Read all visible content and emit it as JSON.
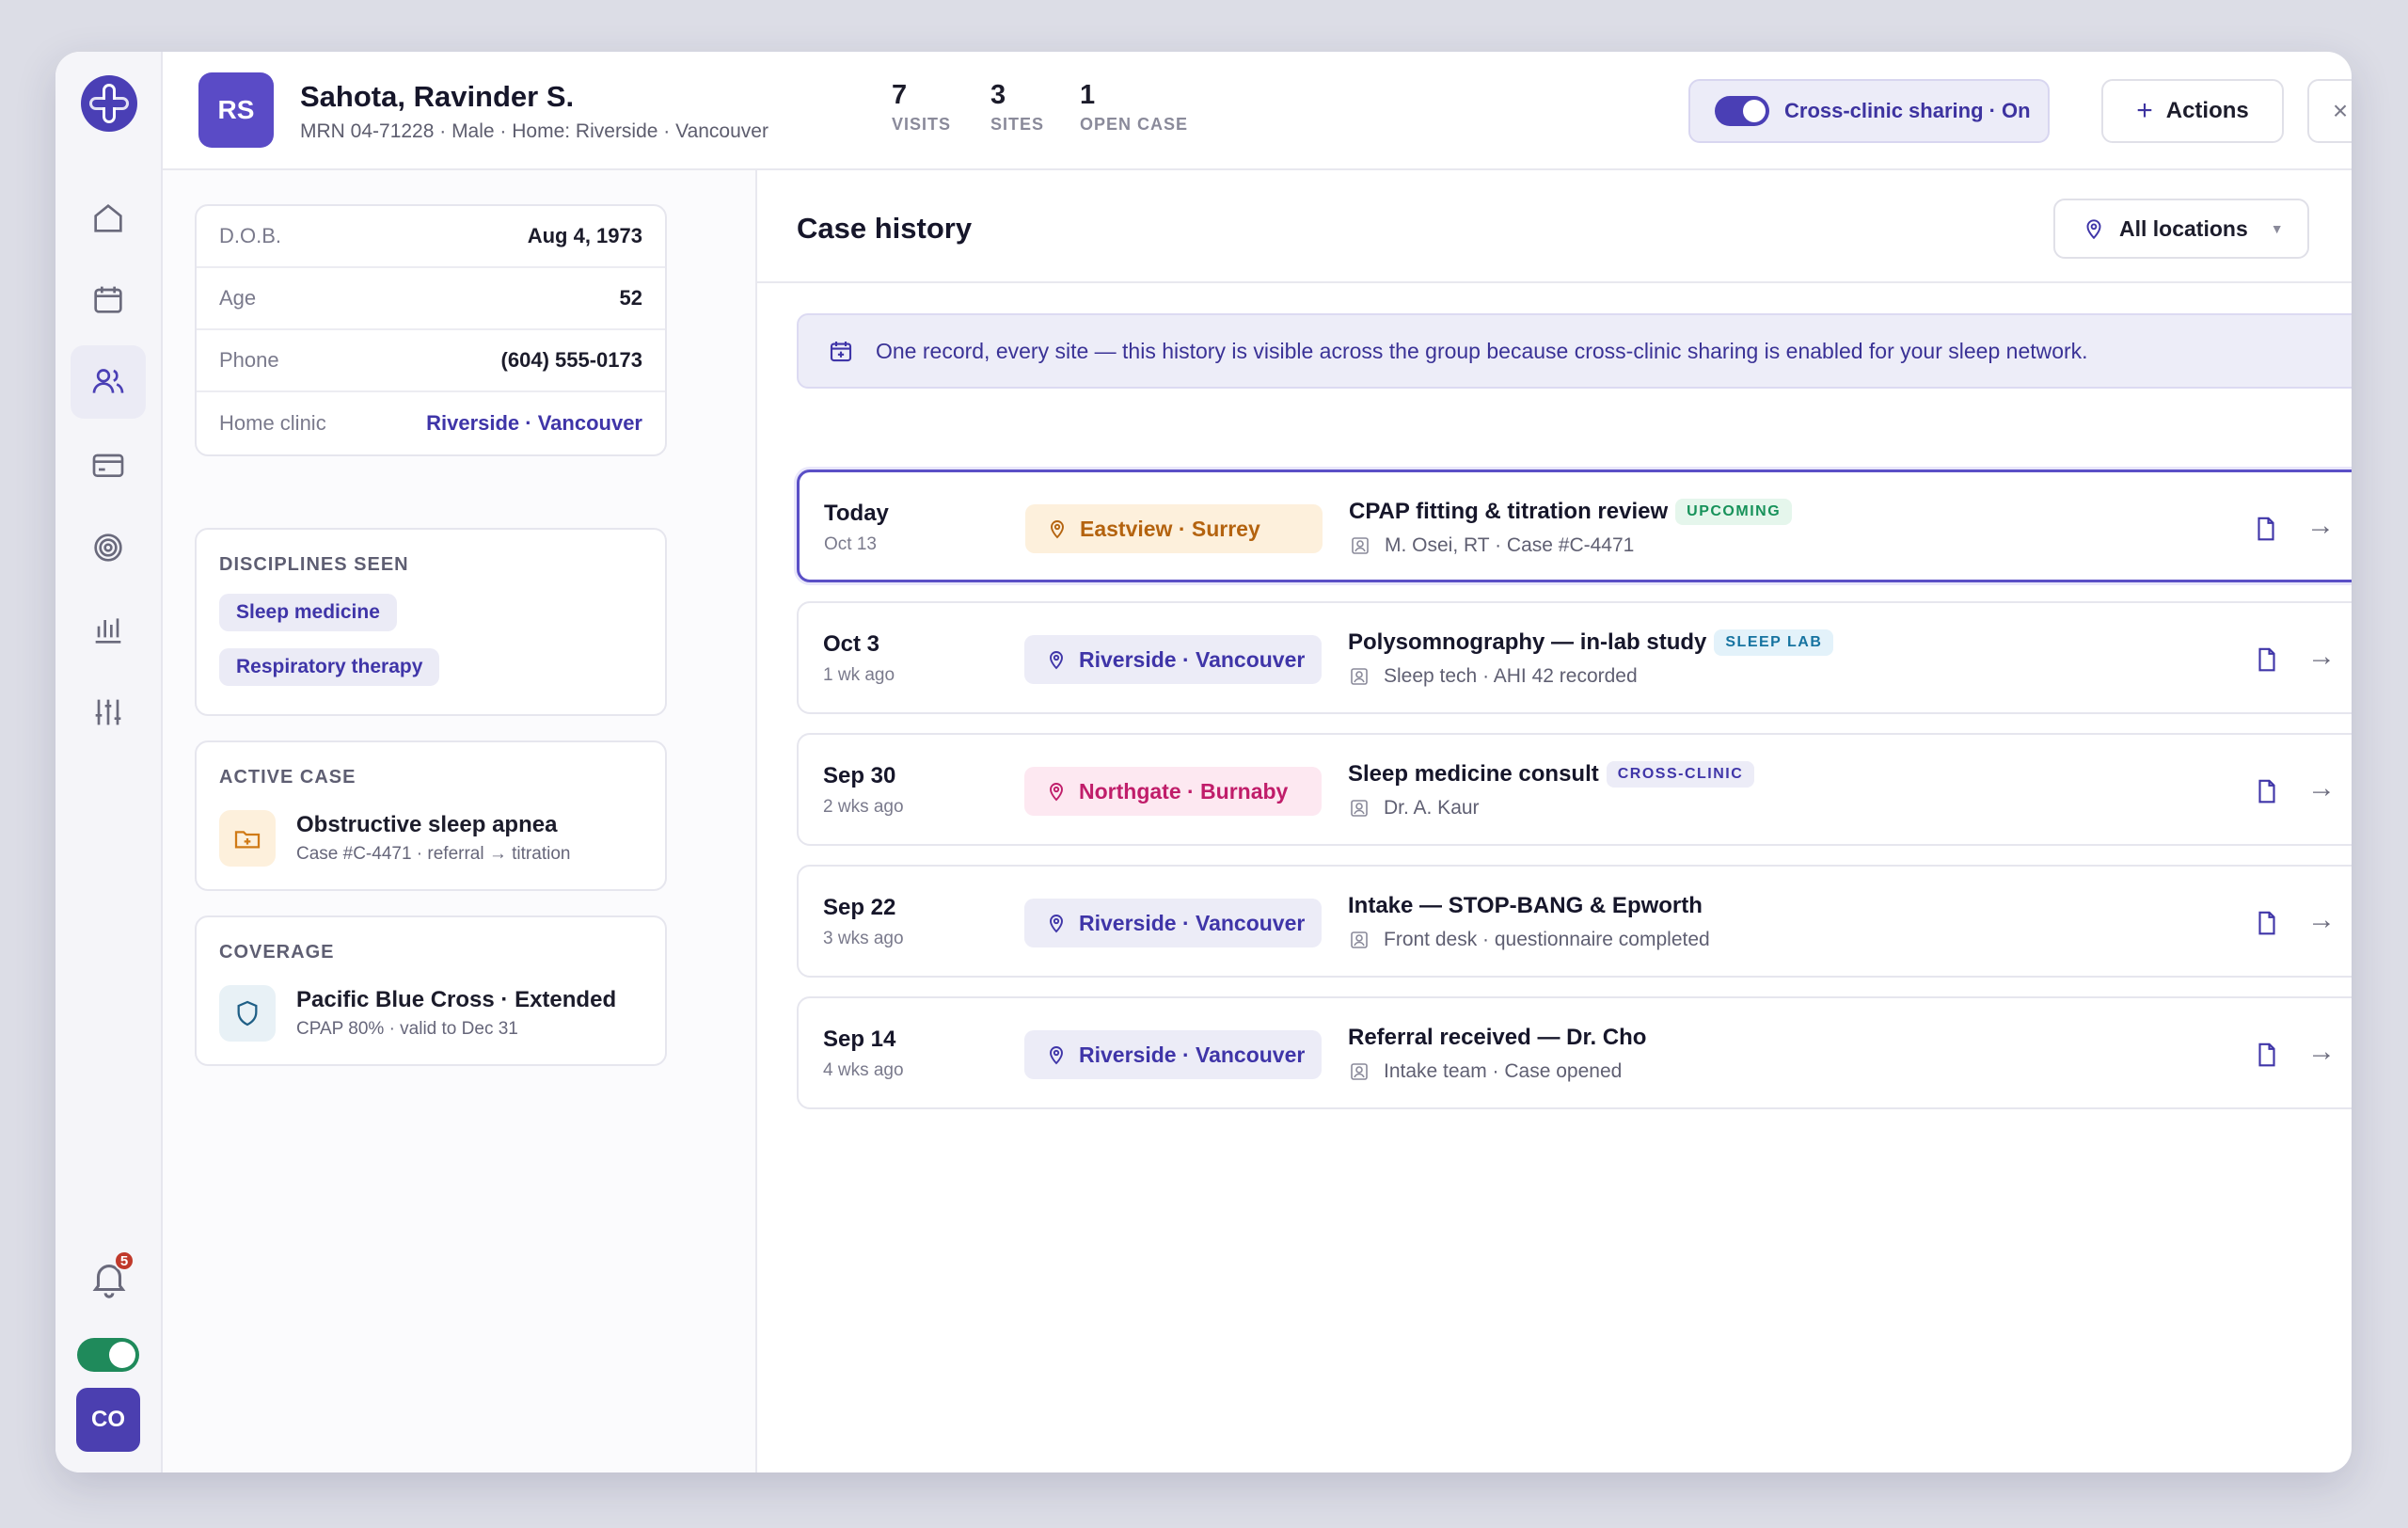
{
  "patient": {
    "initials": "RS",
    "name": "Sahota, Ravinder S.",
    "meta": "MRN 04-71228 · Male · Home: Riverside · Vancouver",
    "stats": [
      {
        "num": "7",
        "label": "VISITS"
      },
      {
        "num": "3",
        "label": "SITES"
      },
      {
        "num": "1",
        "label": "OPEN CASE"
      }
    ]
  },
  "header": {
    "sharing_label": "Cross-clinic sharing · On",
    "actions_label": "Actions",
    "close_label": "×"
  },
  "sidebar": {
    "notification_count": "5",
    "user_initials": "CO",
    "toggle_on": true
  },
  "details": [
    {
      "key": "D.O.B.",
      "value": "Aug 4, 1973"
    },
    {
      "key": "Age",
      "value": "52"
    },
    {
      "key": "Phone",
      "value": "(604) 555-0173"
    },
    {
      "key": "Home clinic",
      "value": "Riverside · Vancouver"
    }
  ],
  "disciplines": {
    "title": "DISCIPLINES SEEN",
    "items": [
      "Sleep medicine",
      "Respiratory therapy"
    ]
  },
  "active_case": {
    "title": "ACTIVE CASE",
    "name": "Obstructive sleep apnea",
    "sub": "Case #C-4471 · referral → titration"
  },
  "coverage": {
    "title": "COVERAGE",
    "name": "Pacific Blue Cross · Extended",
    "sub": "CPAP 80% · valid to Dec 31"
  },
  "history": {
    "title": "Case history",
    "filter_label": "All locations",
    "banner": "One record, every site — this history is visible across the group because cross-clinic sharing is enabled for your sleep network.",
    "rows": [
      {
        "date": "Today",
        "ago": "Oct 13",
        "location": "Eastview · Surrey",
        "title": "CPAP fitting & titration review",
        "tag": "UPCOMING",
        "sub": "M. Osei, RT · Case #C-4471"
      },
      {
        "date": "Oct 3",
        "ago": "1 wk ago",
        "location": "Riverside · Vancouver",
        "title": "Polysomnography — in-lab study",
        "tag": "SLEEP LAB",
        "sub": "Sleep tech · AHI 42 recorded"
      },
      {
        "date": "Sep 30",
        "ago": "2 wks ago",
        "location": "Northgate · Burnaby",
        "title": "Sleep medicine consult",
        "tag": "CROSS-CLINIC",
        "sub": "Dr. A. Kaur"
      },
      {
        "date": "Sep 22",
        "ago": "3 wks ago",
        "location": "Riverside · Vancouver",
        "title": "Intake — STOP-BANG & Epworth",
        "tag": "",
        "sub": "Front desk · questionnaire completed"
      },
      {
        "date": "Sep 14",
        "ago": "4 wks ago",
        "location": "Riverside · Vancouver",
        "title": "Referral received — Dr. Cho",
        "tag": "",
        "sub": "Intake team · Case opened"
      }
    ]
  },
  "colors": {
    "accent": "#4a3fb5",
    "upcoming": "#17925a",
    "eastview": "#b4630f",
    "northgate": "#c01d6a"
  }
}
